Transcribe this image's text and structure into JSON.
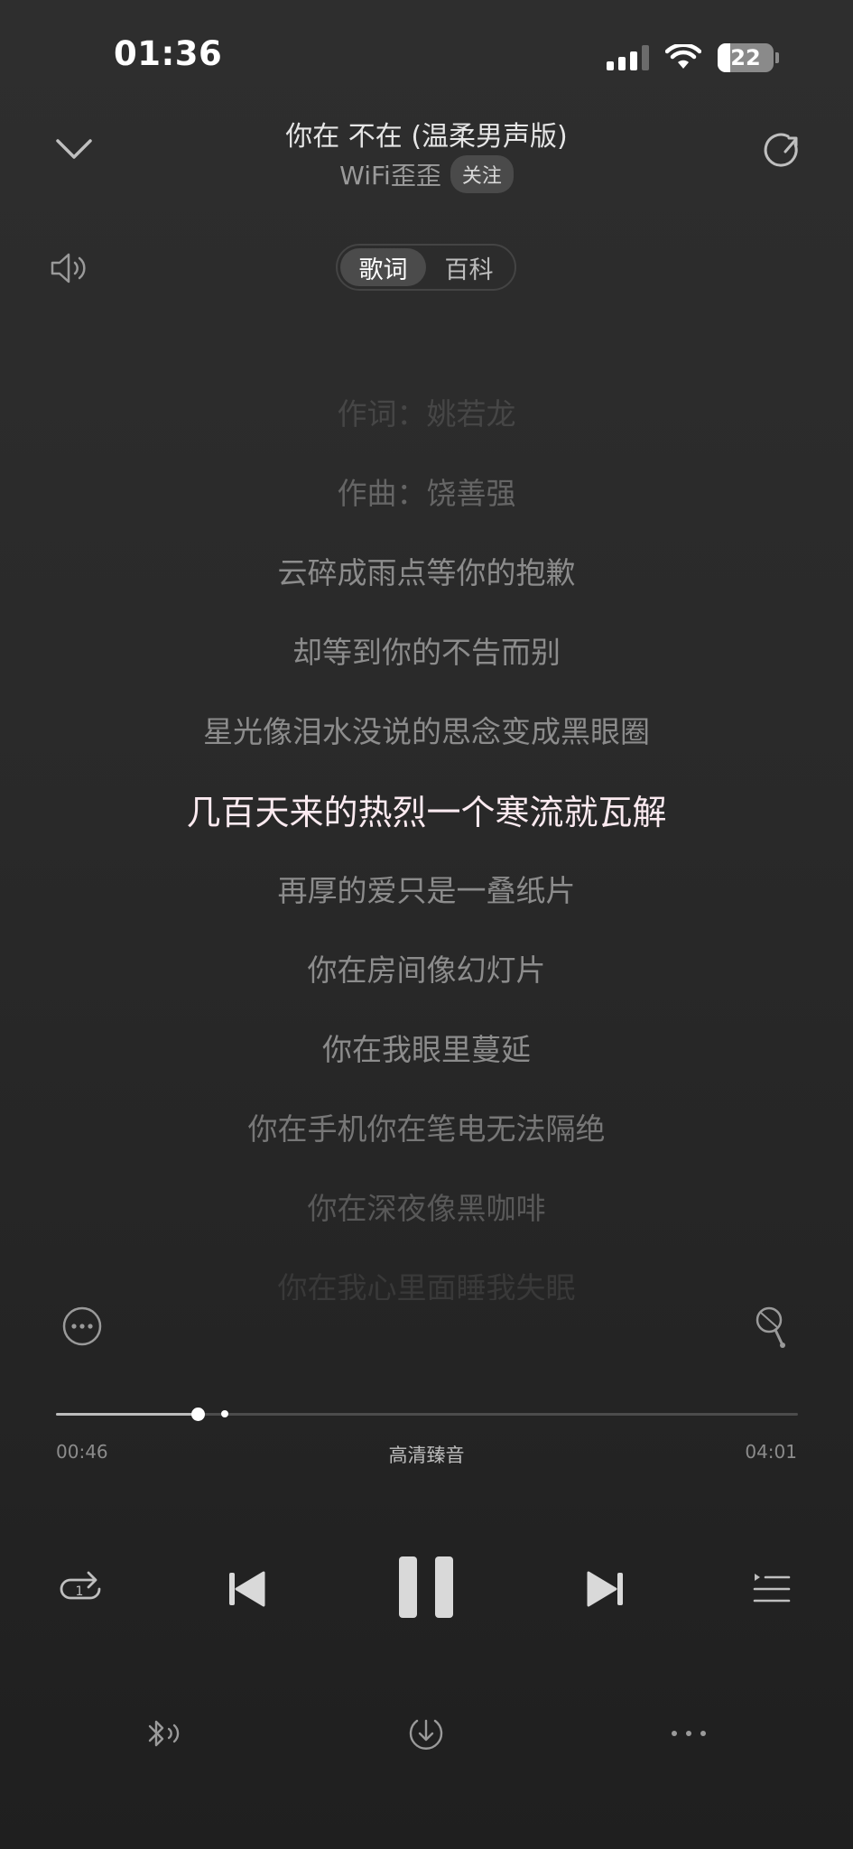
{
  "status_bar": {
    "time": "01:36",
    "battery": "22",
    "battery_level": 0.22
  },
  "header": {
    "title": "你在 不在 (温柔男声版)",
    "artist": "WiFi歪歪",
    "follow_label": "关注",
    "icons": {
      "collapse": "chevron-down-icon",
      "share": "share-icon"
    }
  },
  "tabs": [
    {
      "label": "歌词",
      "active": true
    },
    {
      "label": "百科",
      "active": false
    }
  ],
  "lyrics": [
    "作词：姚若龙",
    "作曲：饶善强",
    "云碎成雨点等你的抱歉",
    "却等到你的不告而别",
    "星光像泪水没说的思念变成黑眼圈",
    "几百天来的热烈一个寒流就瓦解",
    "再厚的爱只是一叠纸片",
    "你在房间像幻灯片",
    "你在我眼里蔓延",
    "你在手机你在笔电无法隔绝",
    "你在深夜像黑咖啡",
    "你在我心里面睡我失眠"
  ],
  "current_lyric_index": 5,
  "playback": {
    "current_time": "00:46",
    "total_time": "04:01",
    "progress": 0.191,
    "buffered": 0.228,
    "quality_label": "高清臻音"
  },
  "colors": {
    "background": "#2c2c2c",
    "current_lyric": "#fbeaf0",
    "lyric": "#8c8c8c"
  }
}
